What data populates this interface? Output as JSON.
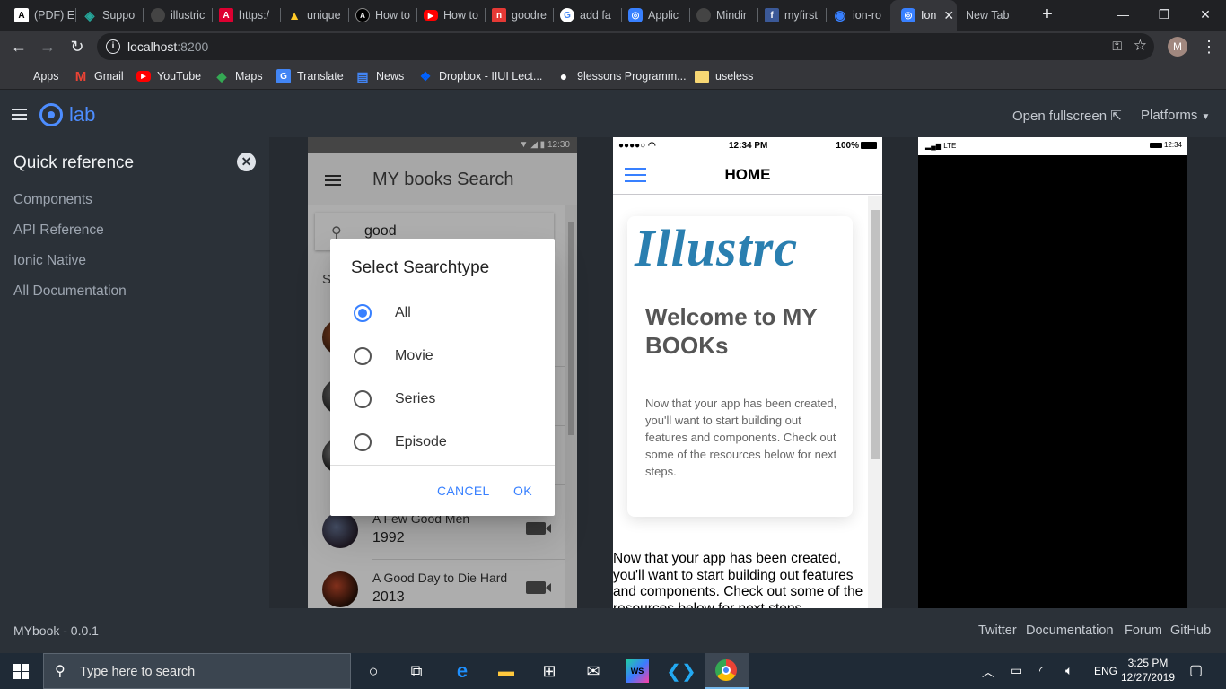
{
  "browser": {
    "tabs": [
      {
        "label": "(PDF) E",
        "icon": "academia-icon",
        "color": "#ffffff"
      },
      {
        "label": "Suppo",
        "icon": "diamond-icon",
        "color": "#26a69a"
      },
      {
        "label": "illustric",
        "icon": "github-icon",
        "color": "#333333"
      },
      {
        "label": "https:/",
        "icon": "angular-icon",
        "color": "#dd0031"
      },
      {
        "label": "unique",
        "icon": "firebase-icon",
        "color": "#ffca28"
      },
      {
        "label": "How to",
        "icon": "autodesk-icon",
        "color": "#202124"
      },
      {
        "label": "How to",
        "icon": "youtube-icon",
        "color": "#ff0000"
      },
      {
        "label": "goodre",
        "icon": "goodreads-icon",
        "color": "#e53935"
      },
      {
        "label": "add fa",
        "icon": "google-icon",
        "color": "#ffffff"
      },
      {
        "label": "Applic",
        "icon": "ionic-icon",
        "color": "#3880ff"
      },
      {
        "label": "Mindir",
        "icon": "github-icon",
        "color": "#333333"
      },
      {
        "label": "myfirst",
        "icon": "facebook-icon",
        "color": "#3b5998"
      },
      {
        "label": "ion-ro",
        "icon": "ionic-icon",
        "color": "#3880ff"
      },
      {
        "label": "Ion",
        "icon": "ionic-icon",
        "color": "#3880ff",
        "active": true
      },
      {
        "label": "New Tab",
        "icon": "",
        "color": ""
      }
    ],
    "url_host": "localhost",
    "url_port": ":8200",
    "profile_initial": "M",
    "bookmarks": [
      {
        "label": "Apps",
        "icon": "apps-grid-icon"
      },
      {
        "label": "Gmail",
        "icon": "gmail-icon"
      },
      {
        "label": "YouTube",
        "icon": "youtube-icon"
      },
      {
        "label": "Maps",
        "icon": "maps-icon"
      },
      {
        "label": "Translate",
        "icon": "translate-icon"
      },
      {
        "label": "News",
        "icon": "news-icon"
      },
      {
        "label": "Dropbox - IIUI Lect...",
        "icon": "dropbox-icon"
      },
      {
        "label": "9lessons Programm...",
        "icon": "bulb-icon"
      },
      {
        "label": "useless",
        "icon": "folder-icon"
      }
    ]
  },
  "lab": {
    "logo_text": "lab",
    "open_fullscreen": "Open fullscreen",
    "platforms": "Platforms",
    "sidebar": {
      "title": "Quick reference",
      "links": [
        "Components",
        "API Reference",
        "Ionic Native",
        "All Documentation"
      ]
    },
    "footer": {
      "version": "MYbook - 0.0.1",
      "links": [
        "Twitter",
        "Documentation",
        "Forum",
        "GitHub"
      ]
    }
  },
  "android": {
    "status_time": "12:30",
    "title": "MY books Search",
    "search_value": "good",
    "segment_partial": "S",
    "items": [
      {
        "title": "A Few Good Men",
        "year": "1992"
      },
      {
        "title": "A Good Day to Die Hard",
        "year": "2013"
      }
    ],
    "alert": {
      "title": "Select Searchtype",
      "options": [
        {
          "label": "All",
          "checked": true
        },
        {
          "label": "Movie",
          "checked": false
        },
        {
          "label": "Series",
          "checked": false
        },
        {
          "label": "Episode",
          "checked": false
        }
      ],
      "cancel": "CANCEL",
      "ok": "OK"
    }
  },
  "ios": {
    "status_time": "12:34 PM",
    "battery": "100%",
    "title": "HOME",
    "card_logo": "Illustrc",
    "card_heading": "Welcome to MY BOOKs",
    "card_text": "Now that your app has been created, you'll want to start building out features and components. Check out some of the resources below for next steps.",
    "body_text": "Now that your app has been created, you'll want to start building out features and components. Check out some of the resources below for next steps."
  },
  "windows_device": {
    "signal": "LTE",
    "time": "12:34"
  },
  "taskbar": {
    "search_placeholder": "Type here to search",
    "language": "ENG",
    "time": "3:25 PM",
    "date": "12/27/2019"
  }
}
